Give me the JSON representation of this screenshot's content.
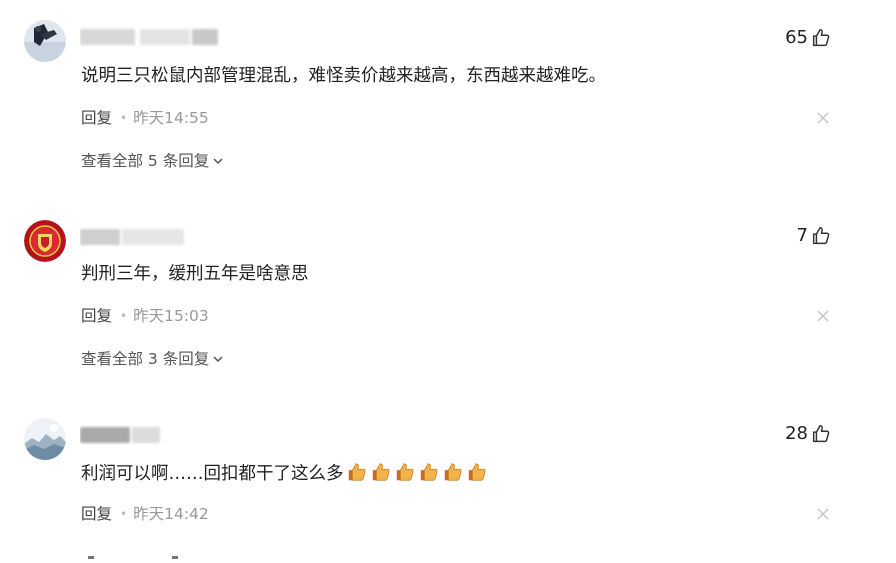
{
  "comments": [
    {
      "likes": "65",
      "text": "说明三只松鼠内部管理混乱，难怪卖价越来越高，东西越来越难吃。",
      "reply_label": "回复",
      "time": "昨天14:55",
      "view_all": "查看全部 5 条回复"
    },
    {
      "likes": "7",
      "text": "判刑三年，缓刑五年是啥意思",
      "reply_label": "回复",
      "time": "昨天15:03",
      "view_all": "查看全部 3 条回复"
    },
    {
      "likes": "28",
      "text": "利润可以啊……回扣都干了这么多",
      "emoji_count": 6,
      "emoji_name": "thumbs-up-emoji",
      "reply_label": "回复",
      "time": "昨天14:42"
    }
  ],
  "icons": {
    "like": "thumb-up-outline-icon",
    "close": "close-icon",
    "chevron": "chevron-down-icon"
  },
  "colors": {
    "text": "#222222",
    "meta": "#999999",
    "reply": "#444444"
  }
}
